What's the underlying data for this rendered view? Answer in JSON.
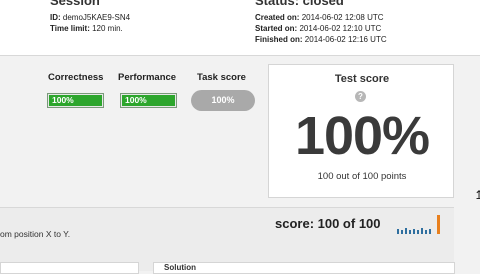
{
  "session": {
    "heading": "Session",
    "id_label": "ID:",
    "id_value": "demoJ5KAE9-SN4",
    "time_label": "Time limit:",
    "time_value": "120 min."
  },
  "status": {
    "heading": "Status: closed",
    "created_label": "Created on:",
    "created_value": "2014-06-02 12:08 UTC",
    "started_label": "Started on:",
    "started_value": "2014-06-02 12:10 UTC",
    "finished_label": "Finished on:",
    "finished_value": "2014-06-02 12:16 UTC"
  },
  "metrics": {
    "correctness_label": "Correctness",
    "correctness_value": "100%",
    "correctness_fraction": 1.0,
    "performance_label": "Performance",
    "performance_value": "100%",
    "performance_fraction": 1.0,
    "task_score_label": "Task score",
    "task_score_value": "100%"
  },
  "test_score": {
    "title": "Test score",
    "help_icon": "?",
    "value": "100%",
    "points": "100 out of 100 points"
  },
  "task": {
    "score": "score: 100 of 100",
    "description_fragment": "om position X to Y.",
    "solution_label": "Solution"
  },
  "colors": {
    "bar_green": "#2ca62c",
    "pill_gray": "#a9a9a9",
    "spark_blue": "#2f6f9f",
    "spark_orange": "#e8801e"
  }
}
